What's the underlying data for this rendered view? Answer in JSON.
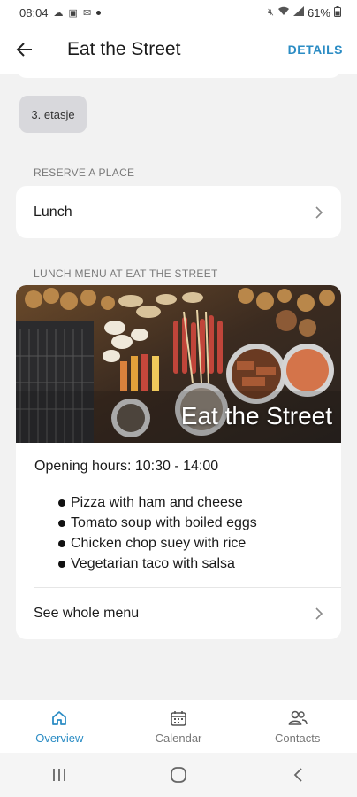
{
  "status_bar": {
    "time": "08:04",
    "battery": "61%"
  },
  "app_bar": {
    "title": "Eat the Street",
    "details_label": "DETAILS"
  },
  "floor_chip": {
    "label": "3. etasje"
  },
  "reserve": {
    "section_label": "RESERVE A PLACE",
    "item_label": "Lunch"
  },
  "menu": {
    "section_label": "LUNCH MENU AT EAT THE STREET",
    "hero_title": "Eat the Street",
    "hours": "Opening hours: 10:30 - 14:00",
    "items": [
      "Pizza with ham and cheese",
      "Tomato soup with boiled eggs",
      "Chicken chop suey with rice",
      "Vegetarian taco with salsa"
    ],
    "see_all_label": "See whole menu"
  },
  "bottom_nav": {
    "items": [
      {
        "label": "Overview",
        "icon": "home-icon",
        "active": true
      },
      {
        "label": "Calendar",
        "icon": "calendar-icon",
        "active": false
      },
      {
        "label": "Contacts",
        "icon": "contacts-icon",
        "active": false
      }
    ]
  },
  "colors": {
    "accent": "#2b8cc4",
    "background": "#f2f2f2",
    "card": "#ffffff",
    "chip": "#d8d8dc"
  }
}
